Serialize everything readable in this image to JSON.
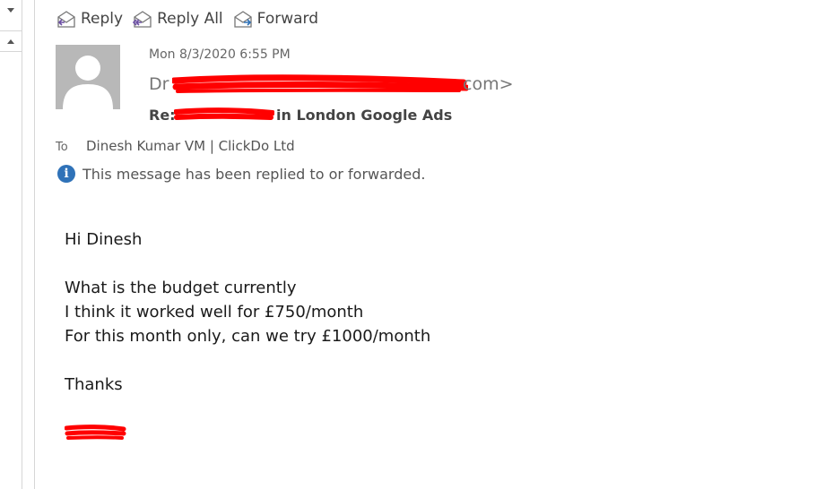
{
  "toolbar": {
    "reply_label": "Reply",
    "reply_all_label": "Reply All",
    "forward_label": "Forward"
  },
  "message": {
    "date": "Mon 8/3/2020 6:55 PM",
    "sender_prefix": "Dr",
    "sender_suffix": "com>",
    "subject_prefix": "Re:",
    "subject_suffix": "in London Google Ads",
    "to_label": "To",
    "to_value": "Dinesh Kumar VM | ClickDo Ltd",
    "info_notice": "This message has been replied to or forwarded."
  },
  "body": {
    "greeting": "Hi Dinesh",
    "line1": "What is the budget currently",
    "line2": "I think it worked well for £750/month",
    "line3": "For this month only, can we try £1000/month",
    "closing": "Thanks"
  },
  "colors": {
    "redaction": "#ff0000",
    "info_icon": "#2f72b8",
    "avatar_bg": "#b8b8b8"
  }
}
